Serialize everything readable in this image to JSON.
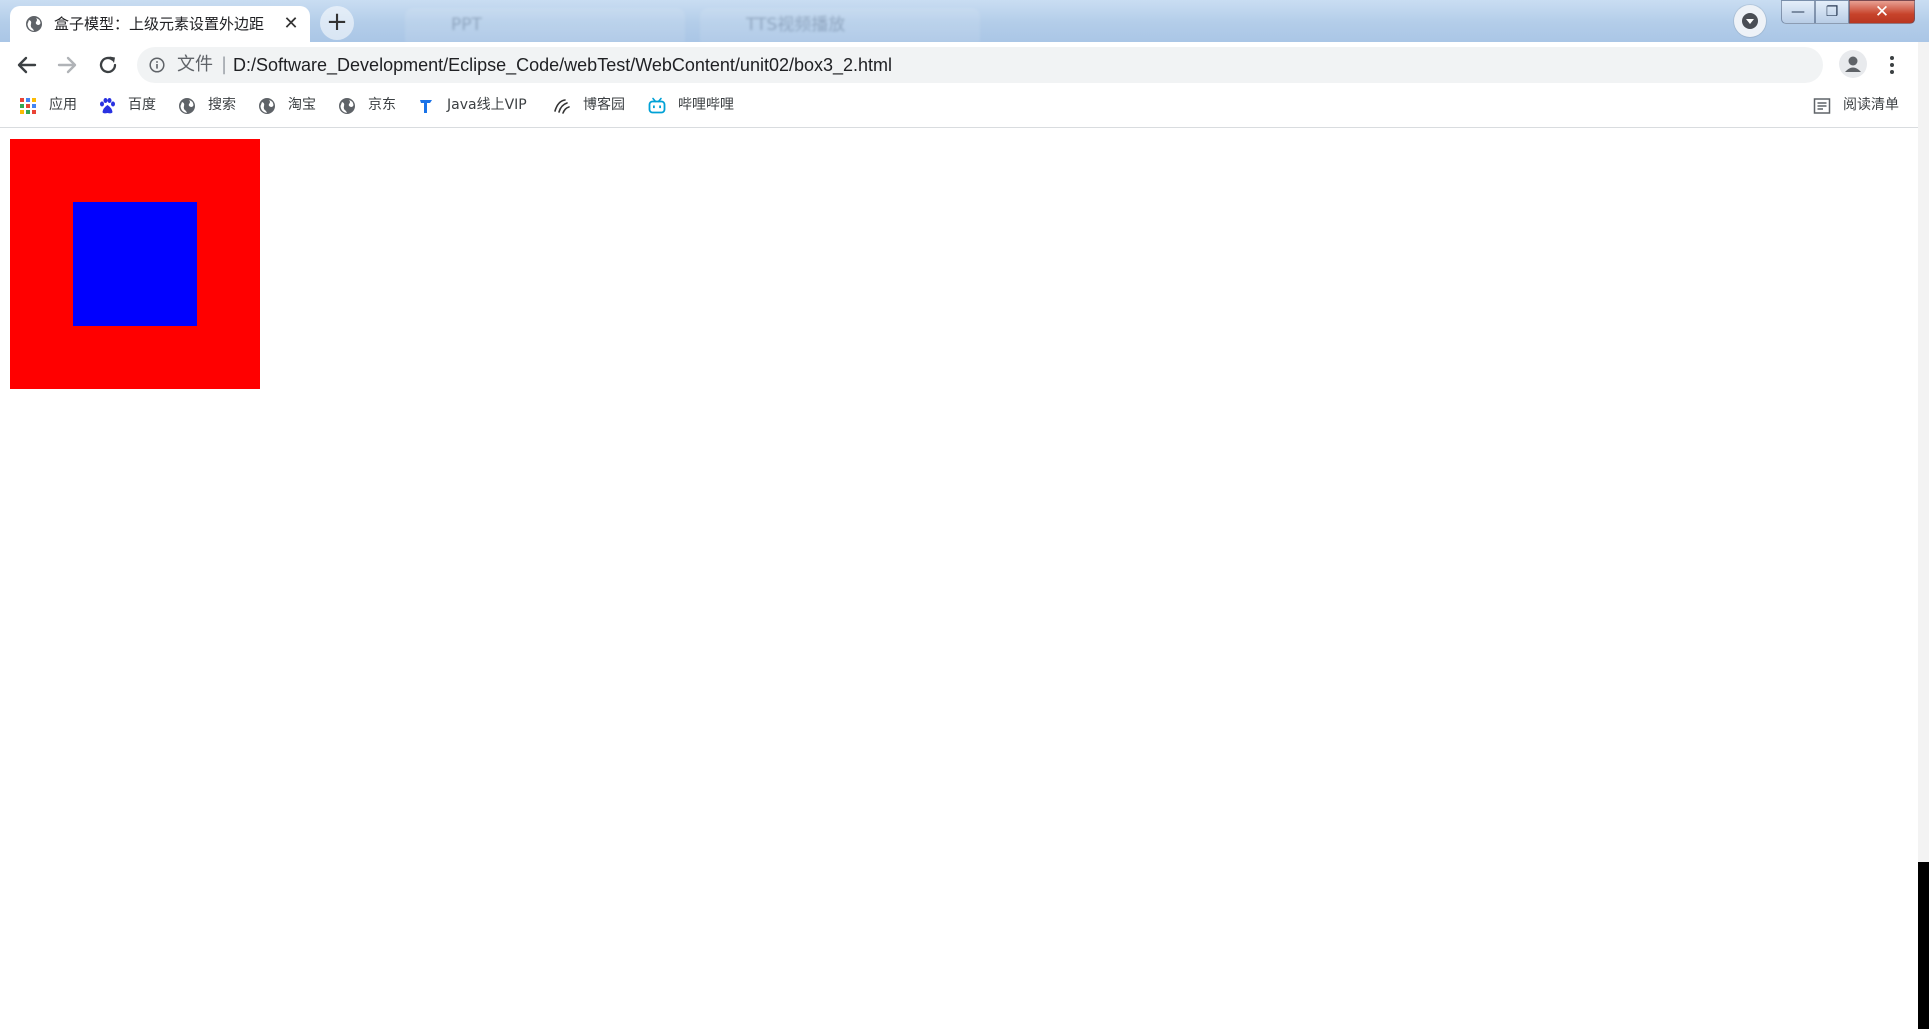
{
  "tab": {
    "title": "盒子模型：上级元素设置外边距",
    "close_glyph": "✕",
    "favicon": "globe-icon"
  },
  "background_tabs": [
    {
      "title": "PPT"
    },
    {
      "title": "TTS视频播放"
    }
  ],
  "new_tab_glyph": "+",
  "window_controls": {
    "minimize": "—",
    "maximize": "❐",
    "close": "✕"
  },
  "omnibox": {
    "scheme_label": "文件",
    "separator": "|",
    "url": "D:/Software_Development/Eclipse_Code/webTest/WebContent/unit02/box3_2.html"
  },
  "bookmarks": [
    {
      "label": "应用",
      "icon": "apps-grid-icon"
    },
    {
      "label": "百度",
      "icon": "baidu-paw-icon"
    },
    {
      "label": "搜索",
      "icon": "globe-icon"
    },
    {
      "label": "淘宝",
      "icon": "globe-icon"
    },
    {
      "label": "京东",
      "icon": "globe-icon"
    },
    {
      "label": "Java线上VIP",
      "icon": "java-icon"
    },
    {
      "label": "博客园",
      "icon": "cnblogs-icon"
    },
    {
      "label": "哔哩哔哩",
      "icon": "bilibili-icon"
    }
  ],
  "reading_list": {
    "label": "阅读清单",
    "icon": "reading-list-icon"
  },
  "page": {
    "outer_box_color": "#ff0000",
    "inner_box_color": "#0000ff"
  }
}
